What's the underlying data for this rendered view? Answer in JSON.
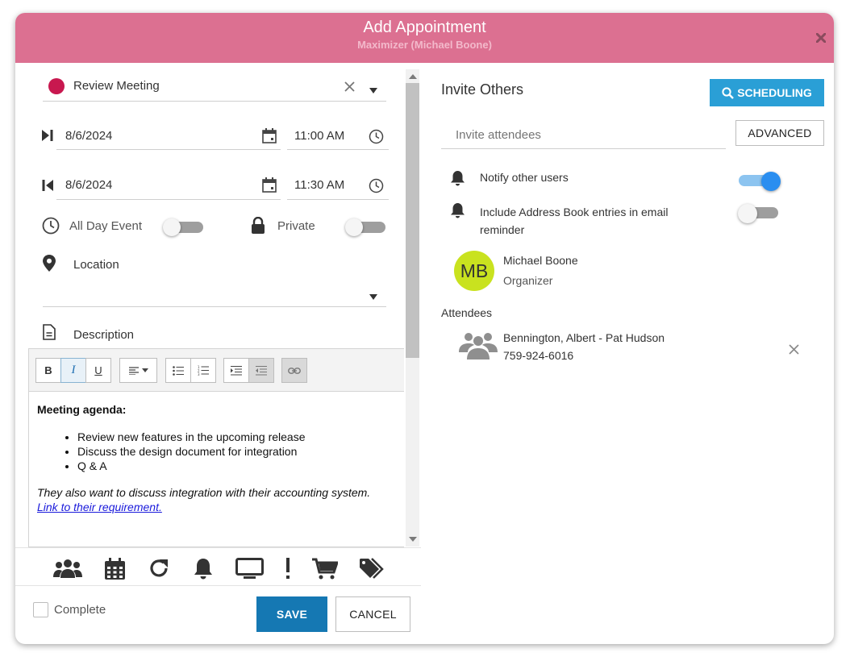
{
  "header": {
    "title": "Add Appointment",
    "subtitle": "Maximizer (Michael Boone)",
    "close_icon": "close-icon"
  },
  "form": {
    "subject": "Review Meeting",
    "category_color": "#c8184f",
    "start_date": "8/6/2024",
    "start_time": "11:00 AM",
    "end_date": "8/6/2024",
    "end_time": "11:30 AM",
    "all_day_label": "All Day Event",
    "all_day_on": false,
    "private_label": "Private",
    "private_on": false,
    "location_label": "Location",
    "location_value": "",
    "description_label": "Description"
  },
  "editor": {
    "toolbar": {
      "bold": "B",
      "italic": "I",
      "underline": "U"
    },
    "heading": "Meeting agenda:",
    "items": [
      "Review new features in the upcoming release",
      "Discuss the design document for integration",
      "Q & A"
    ],
    "note": "They also want to discuss integration with their accounting system.",
    "link_text": "Link to their requirement."
  },
  "icon_bar": [
    "users-icon",
    "calendar-icon",
    "recurrence-icon",
    "bell-icon",
    "monitor-icon",
    "priority-icon",
    "cart-icon",
    "tags-icon"
  ],
  "footer": {
    "complete_label": "Complete",
    "complete_checked": false,
    "save_label": "SAVE",
    "cancel_label": "CANCEL"
  },
  "invite": {
    "title": "Invite Others",
    "scheduling_label": "SCHEDULING",
    "attendees_placeholder": "Invite attendees",
    "advanced_label": "ADVANCED",
    "notify_label": "Notify other users",
    "notify_on": true,
    "include_label_line1": "Include Address Book entries in email",
    "include_label_line2": "reminder",
    "include_on": false
  },
  "organizer": {
    "initials": "MB",
    "name": "Michael Boone",
    "role": "Organizer",
    "avatar_color": "#c9e21f"
  },
  "attendees": {
    "heading": "Attendees",
    "list": [
      {
        "name": "Bennington, Albert - Pat Hudson",
        "phone": "759-924-6016"
      }
    ]
  },
  "colors": {
    "header": "#dc7091",
    "primary_button": "#1578b3",
    "scheduling_button": "#2a9fd6",
    "toggle_on": "#2a8ef0"
  }
}
